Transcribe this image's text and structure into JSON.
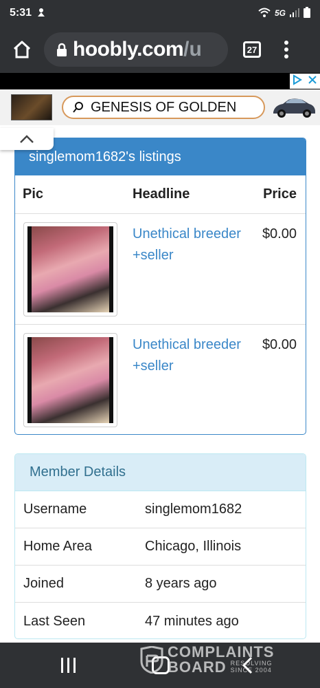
{
  "status_bar": {
    "time": "5:31",
    "network": "5G",
    "icons": [
      "notification-icon",
      "wifi-icon",
      "signal-icon",
      "battery-icon"
    ]
  },
  "browser": {
    "url_domain": "hoobly.com",
    "url_path": "/u",
    "tab_count": "27",
    "icons": [
      "home-icon",
      "lock-icon",
      "tabs-icon",
      "menu-icon"
    ]
  },
  "ad": {
    "search_text": "GENESIS OF GOLDEN",
    "icons": [
      "adchoices-icon",
      "close-icon",
      "search-icon",
      "car-image"
    ]
  },
  "listings": {
    "title": "singlemom1682's listings",
    "columns": [
      "Pic",
      "Headline",
      "Price"
    ],
    "rows": [
      {
        "headline": "Unethical breeder +seller",
        "price": "$0.00"
      },
      {
        "headline": "Unethical breeder +seller",
        "price": "$0.00"
      }
    ]
  },
  "member": {
    "title": "Member Details",
    "rows": [
      {
        "label": "Username",
        "value": "singlemom1682"
      },
      {
        "label": "Home Area",
        "value": "Chicago, Illinois"
      },
      {
        "label": "Joined",
        "value": "8 years ago"
      },
      {
        "label": "Last Seen",
        "value": "47 minutes ago"
      }
    ]
  },
  "watermark": {
    "line1": "COMPLAINTS",
    "line2": "BOARD",
    "tagline1": "RESOLVING",
    "tagline2": "SINCE 2004"
  },
  "colors": {
    "primary": "#3a87c8",
    "info_bg": "#d9edf7",
    "info_text": "#31708f",
    "chrome": "#2f3134"
  }
}
